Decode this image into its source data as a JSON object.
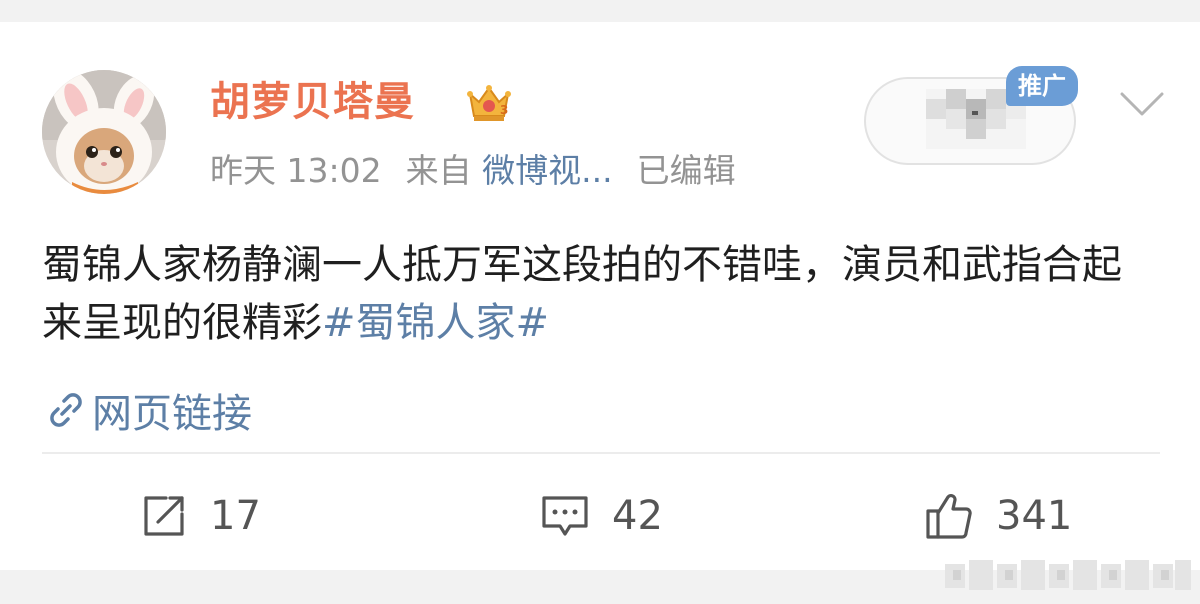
{
  "post": {
    "author": "胡萝贝塔曼",
    "time": "昨天 13:02",
    "source_prefix": "来自",
    "source": "微博视...",
    "edited": "已编辑",
    "promo_badge": "推广",
    "text": "蜀锦人家杨静澜一人抵万军这段拍的不错哇，演员和武指合起来呈现的很精彩",
    "topic": "#蜀锦人家#",
    "link_label": "网页链接"
  },
  "actions": {
    "repost_count": "17",
    "comment_count": "42",
    "like_count": "341"
  },
  "icons": {
    "avatar": "avatar-cat-bunny-ears",
    "crown": "crown-vip-icon",
    "link": "link-icon",
    "repost": "repost-icon",
    "comment": "comment-icon",
    "like": "thumbs-up-icon",
    "more": "chevron-down-icon"
  },
  "colors": {
    "username": "#eb7350",
    "link_blue": "#5d7fa6",
    "meta_gray": "#939393",
    "badge_blue": "#6b9dd6",
    "text": "#1f1f1f"
  }
}
